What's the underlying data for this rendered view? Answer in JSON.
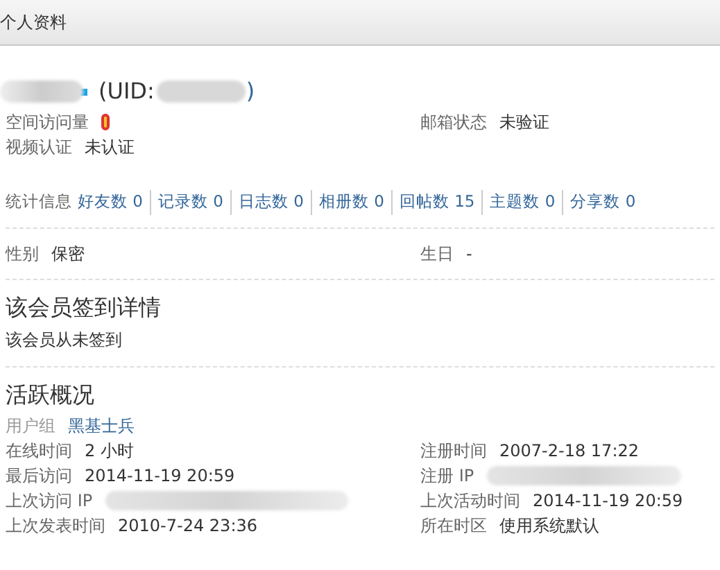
{
  "header": {
    "title": "个人资料"
  },
  "profile": {
    "uid_prefix": "(UID:",
    "uid_suffix": ")"
  },
  "info_rows": [
    {
      "left": {
        "label": "空间访问量",
        "kind": "badge"
      },
      "right": {
        "label": "邮箱状态",
        "value": "未验证",
        "kind": "text"
      }
    },
    {
      "left": {
        "label": "视频认证",
        "value": "未认证",
        "kind": "text"
      }
    }
  ],
  "stats": {
    "label": "统计信息",
    "items": [
      {
        "label": "好友数 0"
      },
      {
        "label": "记录数 0"
      },
      {
        "label": "日志数 0"
      },
      {
        "label": "相册数 0"
      },
      {
        "label": "回帖数 15"
      },
      {
        "label": "主题数 0"
      },
      {
        "label": "分享数 0"
      }
    ]
  },
  "personal_rows": [
    {
      "left": {
        "label": "性别",
        "value": "保密",
        "kind": "text"
      },
      "right": {
        "label": "生日",
        "value": "-",
        "kind": "text"
      }
    }
  ],
  "signin": {
    "title": "该会员签到详情",
    "text": "该会员从未签到"
  },
  "activity": {
    "title": "活跃概况",
    "group_label": "用户组",
    "group_value": "黑基士兵",
    "rows": [
      {
        "left": {
          "label": "在线时间",
          "value": "2 小时",
          "kind": "text"
        },
        "right": {
          "label": "注册时间",
          "value": "2007-2-18 17:22",
          "kind": "text"
        }
      },
      {
        "left": {
          "label": "最后访问",
          "value": "2014-11-19 20:59",
          "kind": "text"
        },
        "right": {
          "label": "注册 IP",
          "kind": "blurred"
        }
      },
      {
        "left": {
          "label": "上次访问 IP",
          "kind": "blurred"
        },
        "right": {
          "label": "上次活动时间",
          "value": "2014-11-19 20:59",
          "kind": "text"
        }
      },
      {
        "left": {
          "label": "上次发表时间",
          "value": "2010-7-24 23:36",
          "kind": "text"
        },
        "right": {
          "label": "所在时区",
          "value": "使用系统默认",
          "kind": "text"
        }
      }
    ]
  }
}
